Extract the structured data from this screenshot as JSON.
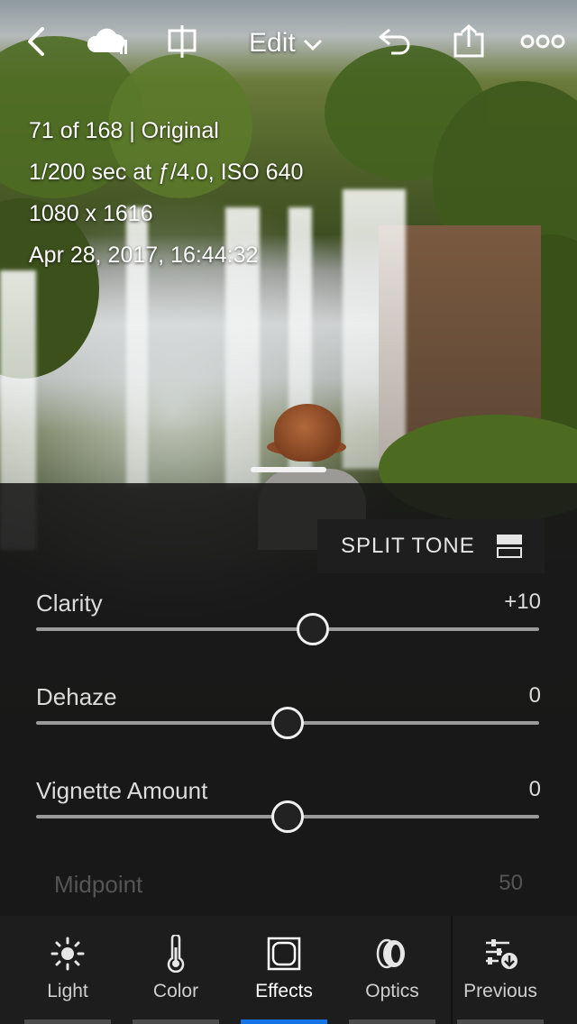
{
  "header": {
    "edit_label": "Edit",
    "icons": [
      "back-chevron-icon",
      "cloud-sync-icon",
      "compare-icon",
      "edit-dropdown-chevron-icon",
      "undo-icon",
      "share-icon",
      "more-icon"
    ]
  },
  "photo_info": {
    "line1": "71 of 168 | Original",
    "line2": "1/200 sec at ƒ/4.0, ISO 640",
    "line3": "1080 x 1616",
    "line4": "Apr 28, 2017, 16:44:32"
  },
  "panel": {
    "split_tone_label": "SPLIT TONE",
    "sliders": [
      {
        "label": "Clarity",
        "value": "+10",
        "position": 0.55
      },
      {
        "label": "Dehaze",
        "value": "0",
        "position": 0.5
      },
      {
        "label": "Vignette Amount",
        "value": "0",
        "position": 0.5
      },
      {
        "label": "Midpoint",
        "value": "50",
        "position": 0.5
      }
    ]
  },
  "tabs": [
    {
      "label": "Light",
      "icon": "sun-icon",
      "active": false
    },
    {
      "label": "Color",
      "icon": "thermometer-icon",
      "active": false
    },
    {
      "label": "Effects",
      "icon": "vignette-icon",
      "active": true
    },
    {
      "label": "Optics",
      "icon": "lens-icon",
      "active": false
    },
    {
      "label": "Previous",
      "icon": "sliders-download-icon",
      "active": false
    }
  ],
  "colors": {
    "accent": "#1473e6",
    "panel_bg": "#181818"
  }
}
